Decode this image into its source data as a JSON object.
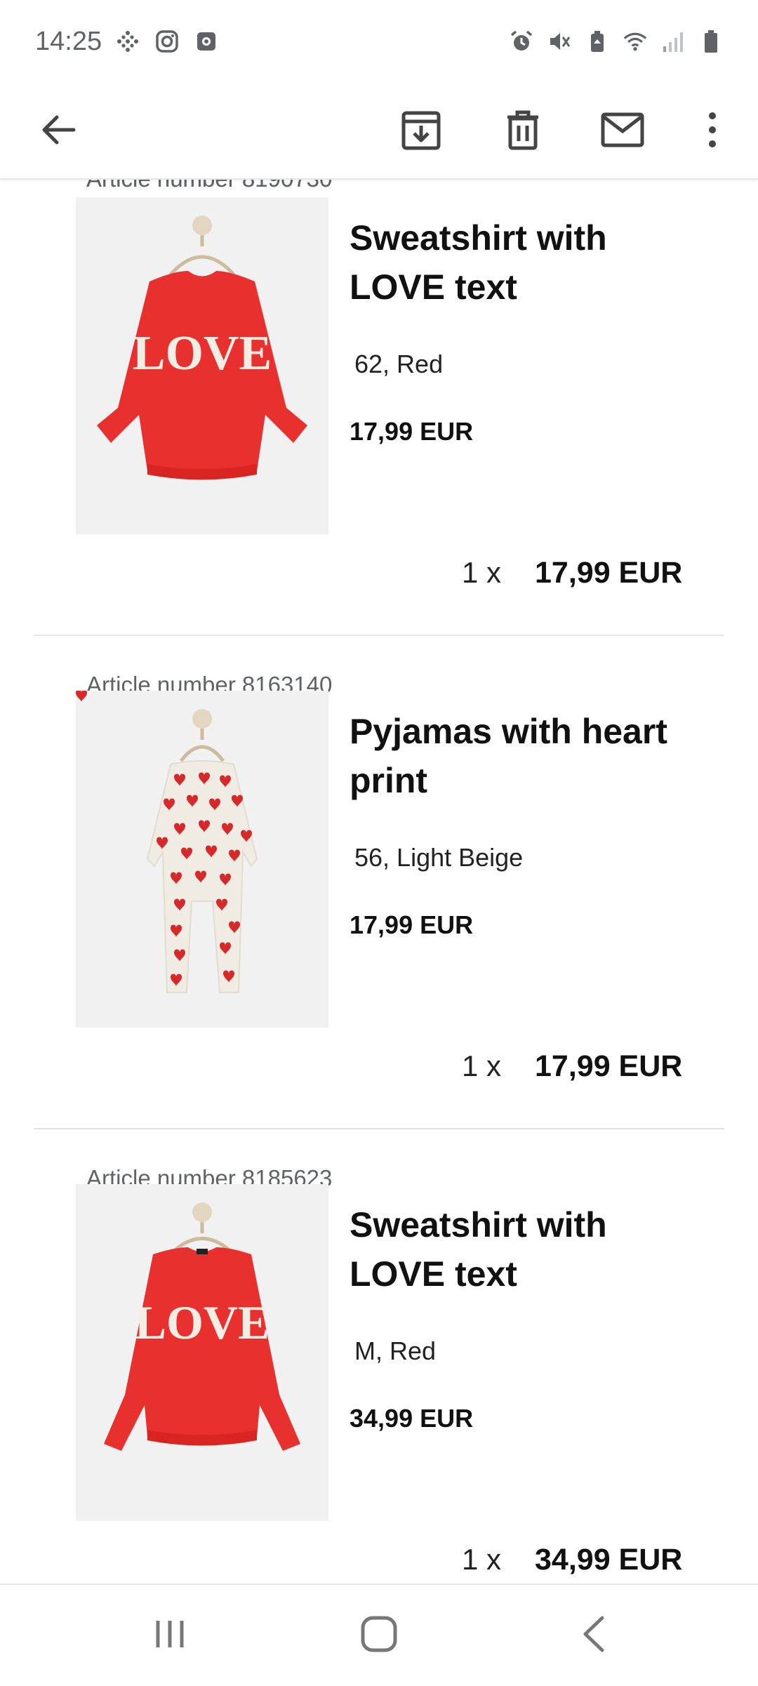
{
  "status_bar": {
    "time": "14:25",
    "left_icons": [
      "grid-dots-icon",
      "instagram-icon",
      "app-notification-icon"
    ],
    "right_icons": [
      "alarm-icon",
      "vibrate-icon",
      "battery-saver-icon",
      "wifi-icon",
      "signal-icon",
      "battery-icon"
    ]
  },
  "app_bar": {
    "actions": [
      "back-arrow-icon",
      "archive-icon",
      "delete-icon",
      "mail-icon",
      "more-vert-icon"
    ]
  },
  "products": [
    {
      "article": "Article number 8190730",
      "name_line1": "Sweatshirt with",
      "name_line2": "LOVE text",
      "variant": "62, Red",
      "unit_price": "17,99 EUR",
      "quantity": "1 x",
      "line_price": "17,99 EUR",
      "image_text": "LOVE"
    },
    {
      "article": "Article number 8163140",
      "name_line1": "Pyjamas with heart",
      "name_line2": "print",
      "variant": "56, Light Beige",
      "unit_price": "17,99 EUR",
      "quantity": "1 x",
      "line_price": "17,99 EUR"
    },
    {
      "article": "Article number 8185623",
      "name_line1": "Sweatshirt with",
      "name_line2": "LOVE text",
      "variant": "M, Red",
      "unit_price": "34,99 EUR",
      "quantity": "1 x",
      "line_price": "34,99 EUR",
      "image_text": "LOVE"
    }
  ],
  "nav_bar": {
    "buttons": [
      "recent-apps-icon",
      "home-icon",
      "back-icon"
    ]
  },
  "colors": {
    "sweater_red": "#e8312f",
    "heart_red": "#d7282a",
    "pyjama_beige": "#f1ece3",
    "muted_text": "#5f6368"
  }
}
